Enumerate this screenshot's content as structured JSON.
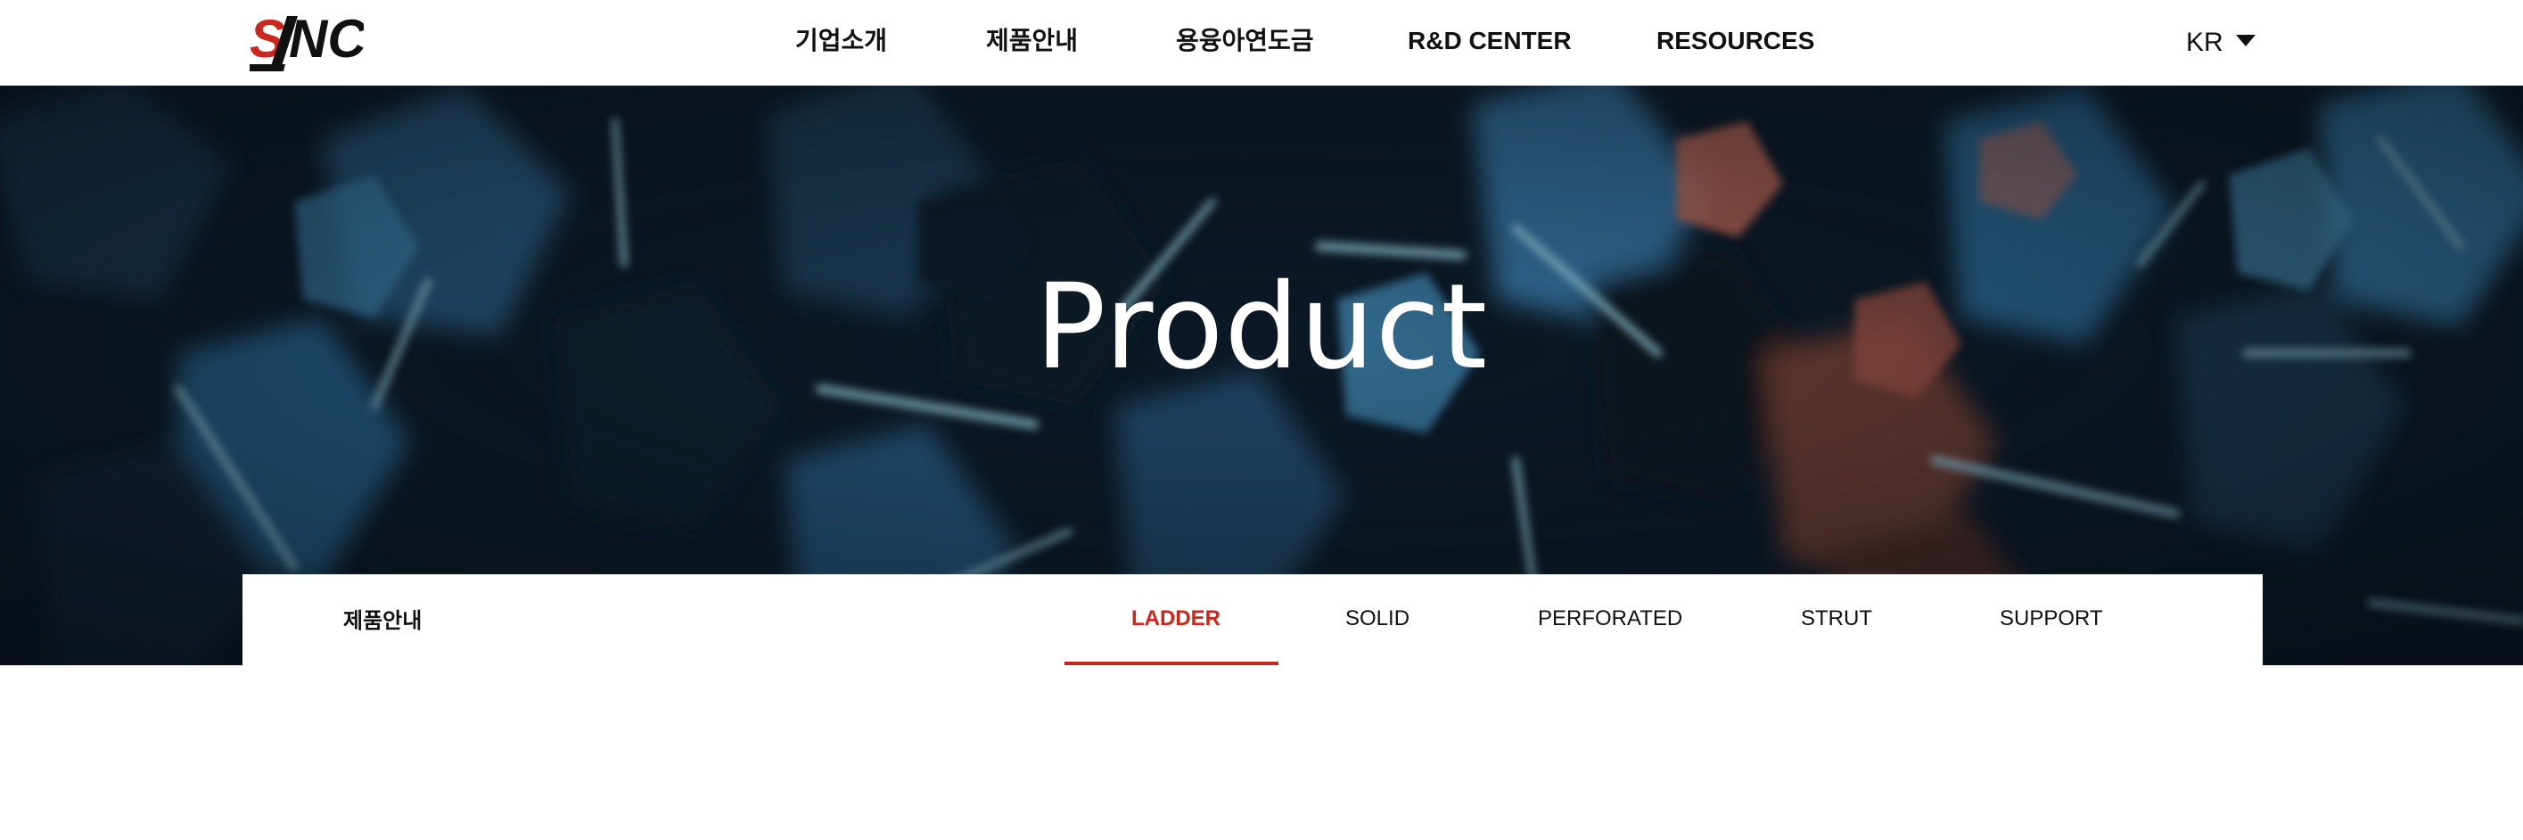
{
  "header": {
    "logo_text": "SNC",
    "nav": [
      {
        "label": "기업소개"
      },
      {
        "label": "제품안내"
      },
      {
        "label": "용융아연도금"
      },
      {
        "label": "R&D CENTER"
      },
      {
        "label": "RESOURCES"
      }
    ],
    "language": {
      "label": "KR",
      "icon": "caret-down-icon"
    }
  },
  "hero": {
    "title": "Product"
  },
  "subnav": {
    "section_title": "제품안내",
    "tabs": [
      {
        "label": "LADDER",
        "active": true
      },
      {
        "label": "SOLID",
        "active": false
      },
      {
        "label": "PERFORATED",
        "active": false
      },
      {
        "label": "STRUT",
        "active": false
      },
      {
        "label": "SUPPORT",
        "active": false
      }
    ]
  },
  "colors": {
    "accent": "#c8281e",
    "hero_dark": "#0b1622",
    "hero_cyan": "#5fb6df"
  }
}
